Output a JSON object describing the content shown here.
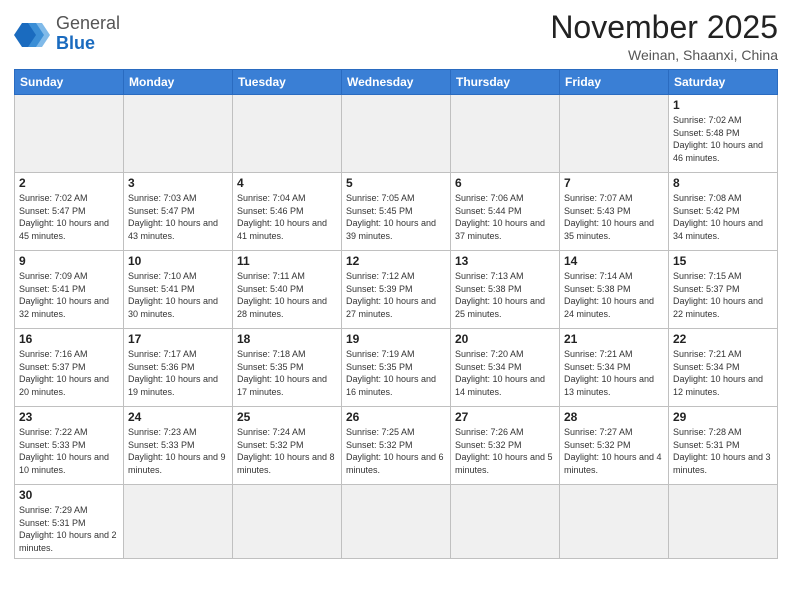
{
  "logo": {
    "general": "General",
    "blue": "Blue"
  },
  "title": "November 2025",
  "subtitle": "Weinan, Shaanxi, China",
  "weekdays": [
    "Sunday",
    "Monday",
    "Tuesday",
    "Wednesday",
    "Thursday",
    "Friday",
    "Saturday"
  ],
  "days": [
    {
      "day": "",
      "sunrise": "",
      "sunset": "",
      "daylight": ""
    },
    {
      "day": "",
      "sunrise": "",
      "sunset": "",
      "daylight": ""
    },
    {
      "day": "",
      "sunrise": "",
      "sunset": "",
      "daylight": ""
    },
    {
      "day": "",
      "sunrise": "",
      "sunset": "",
      "daylight": ""
    },
    {
      "day": "",
      "sunrise": "",
      "sunset": "",
      "daylight": ""
    },
    {
      "day": "",
      "sunrise": "",
      "sunset": "",
      "daylight": ""
    },
    {
      "day": "1",
      "sunrise": "Sunrise: 7:02 AM",
      "sunset": "Sunset: 5:48 PM",
      "daylight": "Daylight: 10 hours and 46 minutes."
    },
    {
      "day": "2",
      "sunrise": "Sunrise: 7:02 AM",
      "sunset": "Sunset: 5:47 PM",
      "daylight": "Daylight: 10 hours and 45 minutes."
    },
    {
      "day": "3",
      "sunrise": "Sunrise: 7:03 AM",
      "sunset": "Sunset: 5:47 PM",
      "daylight": "Daylight: 10 hours and 43 minutes."
    },
    {
      "day": "4",
      "sunrise": "Sunrise: 7:04 AM",
      "sunset": "Sunset: 5:46 PM",
      "daylight": "Daylight: 10 hours and 41 minutes."
    },
    {
      "day": "5",
      "sunrise": "Sunrise: 7:05 AM",
      "sunset": "Sunset: 5:45 PM",
      "daylight": "Daylight: 10 hours and 39 minutes."
    },
    {
      "day": "6",
      "sunrise": "Sunrise: 7:06 AM",
      "sunset": "Sunset: 5:44 PM",
      "daylight": "Daylight: 10 hours and 37 minutes."
    },
    {
      "day": "7",
      "sunrise": "Sunrise: 7:07 AM",
      "sunset": "Sunset: 5:43 PM",
      "daylight": "Daylight: 10 hours and 35 minutes."
    },
    {
      "day": "8",
      "sunrise": "Sunrise: 7:08 AM",
      "sunset": "Sunset: 5:42 PM",
      "daylight": "Daylight: 10 hours and 34 minutes."
    },
    {
      "day": "9",
      "sunrise": "Sunrise: 7:09 AM",
      "sunset": "Sunset: 5:41 PM",
      "daylight": "Daylight: 10 hours and 32 minutes."
    },
    {
      "day": "10",
      "sunrise": "Sunrise: 7:10 AM",
      "sunset": "Sunset: 5:41 PM",
      "daylight": "Daylight: 10 hours and 30 minutes."
    },
    {
      "day": "11",
      "sunrise": "Sunrise: 7:11 AM",
      "sunset": "Sunset: 5:40 PM",
      "daylight": "Daylight: 10 hours and 28 minutes."
    },
    {
      "day": "12",
      "sunrise": "Sunrise: 7:12 AM",
      "sunset": "Sunset: 5:39 PM",
      "daylight": "Daylight: 10 hours and 27 minutes."
    },
    {
      "day": "13",
      "sunrise": "Sunrise: 7:13 AM",
      "sunset": "Sunset: 5:38 PM",
      "daylight": "Daylight: 10 hours and 25 minutes."
    },
    {
      "day": "14",
      "sunrise": "Sunrise: 7:14 AM",
      "sunset": "Sunset: 5:38 PM",
      "daylight": "Daylight: 10 hours and 24 minutes."
    },
    {
      "day": "15",
      "sunrise": "Sunrise: 7:15 AM",
      "sunset": "Sunset: 5:37 PM",
      "daylight": "Daylight: 10 hours and 22 minutes."
    },
    {
      "day": "16",
      "sunrise": "Sunrise: 7:16 AM",
      "sunset": "Sunset: 5:37 PM",
      "daylight": "Daylight: 10 hours and 20 minutes."
    },
    {
      "day": "17",
      "sunrise": "Sunrise: 7:17 AM",
      "sunset": "Sunset: 5:36 PM",
      "daylight": "Daylight: 10 hours and 19 minutes."
    },
    {
      "day": "18",
      "sunrise": "Sunrise: 7:18 AM",
      "sunset": "Sunset: 5:35 PM",
      "daylight": "Daylight: 10 hours and 17 minutes."
    },
    {
      "day": "19",
      "sunrise": "Sunrise: 7:19 AM",
      "sunset": "Sunset: 5:35 PM",
      "daylight": "Daylight: 10 hours and 16 minutes."
    },
    {
      "day": "20",
      "sunrise": "Sunrise: 7:20 AM",
      "sunset": "Sunset: 5:34 PM",
      "daylight": "Daylight: 10 hours and 14 minutes."
    },
    {
      "day": "21",
      "sunrise": "Sunrise: 7:21 AM",
      "sunset": "Sunset: 5:34 PM",
      "daylight": "Daylight: 10 hours and 13 minutes."
    },
    {
      "day": "22",
      "sunrise": "Sunrise: 7:21 AM",
      "sunset": "Sunset: 5:34 PM",
      "daylight": "Daylight: 10 hours and 12 minutes."
    },
    {
      "day": "23",
      "sunrise": "Sunrise: 7:22 AM",
      "sunset": "Sunset: 5:33 PM",
      "daylight": "Daylight: 10 hours and 10 minutes."
    },
    {
      "day": "24",
      "sunrise": "Sunrise: 7:23 AM",
      "sunset": "Sunset: 5:33 PM",
      "daylight": "Daylight: 10 hours and 9 minutes."
    },
    {
      "day": "25",
      "sunrise": "Sunrise: 7:24 AM",
      "sunset": "Sunset: 5:32 PM",
      "daylight": "Daylight: 10 hours and 8 minutes."
    },
    {
      "day": "26",
      "sunrise": "Sunrise: 7:25 AM",
      "sunset": "Sunset: 5:32 PM",
      "daylight": "Daylight: 10 hours and 6 minutes."
    },
    {
      "day": "27",
      "sunrise": "Sunrise: 7:26 AM",
      "sunset": "Sunset: 5:32 PM",
      "daylight": "Daylight: 10 hours and 5 minutes."
    },
    {
      "day": "28",
      "sunrise": "Sunrise: 7:27 AM",
      "sunset": "Sunset: 5:32 PM",
      "daylight": "Daylight: 10 hours and 4 minutes."
    },
    {
      "day": "29",
      "sunrise": "Sunrise: 7:28 AM",
      "sunset": "Sunset: 5:31 PM",
      "daylight": "Daylight: 10 hours and 3 minutes."
    },
    {
      "day": "30",
      "sunrise": "Sunrise: 7:29 AM",
      "sunset": "Sunset: 5:31 PM",
      "daylight": "Daylight: 10 hours and 2 minutes."
    }
  ]
}
